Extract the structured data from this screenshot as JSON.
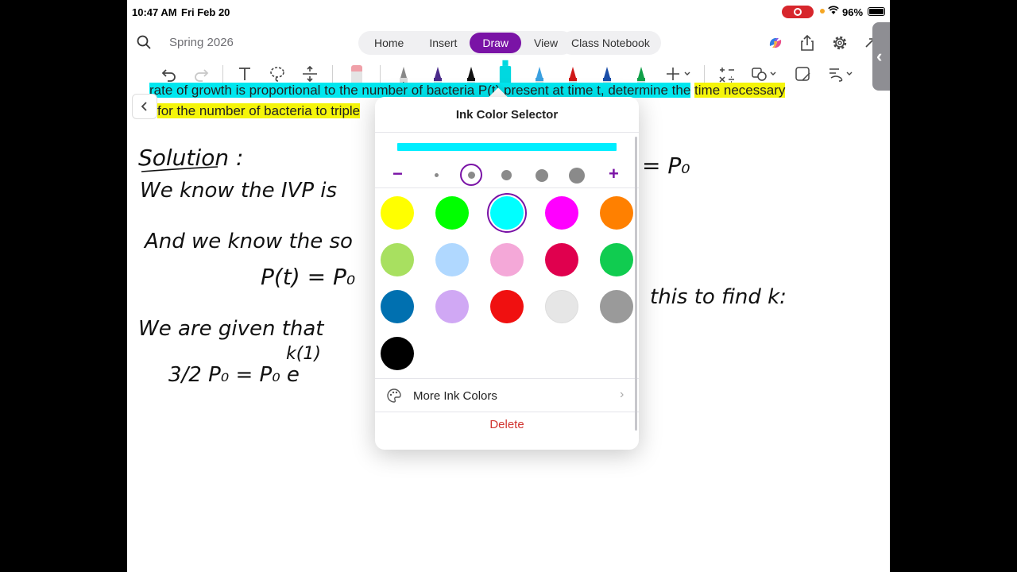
{
  "status": {
    "time": "10:47 AM",
    "date": "Fri Feb 20",
    "battery": "96%"
  },
  "topbar": {
    "notebook_title": "Spring 2026",
    "tabs": [
      {
        "label": "Home"
      },
      {
        "label": "Insert"
      },
      {
        "label": "Draw",
        "active": true
      },
      {
        "label": "View"
      }
    ],
    "class_notebook": "Class Notebook"
  },
  "page": {
    "line1": "rate of growth is proportional to the number of bacteria P(t) present at time t, determine the",
    "line1_yellow": "time necessary",
    "line2_yellow": "for the number of bacteria to triple",
    "handwriting": {
      "solution": "Solution :",
      "ivp": "We know the IVP is",
      "p0_right": "= P₀",
      "sol": "And we know the so",
      "pt": "P(t) = P₀",
      "use": "this to find k:",
      "given": "We are given that",
      "eq": "3/2 P₀ = P₀ e",
      "exp": "k(1)"
    }
  },
  "popover": {
    "title": "Ink Color Selector",
    "preview_color": "#00eeff",
    "selected_size_index": 1,
    "selected_color": "#00ffff",
    "colors": [
      "#ffff00",
      "#00ff00",
      "#00ffff",
      "#ff00ff",
      "#ff8000",
      "#a8e060",
      "#b0d8ff",
      "#f4a8d8",
      "#e0004e",
      "#10cc50",
      "#0070b0",
      "#d0a8f4",
      "#f01010",
      "#e6e6e6",
      "#9a9a9a",
      "#000000"
    ],
    "more_label": "More Ink Colors",
    "delete_label": "Delete"
  }
}
